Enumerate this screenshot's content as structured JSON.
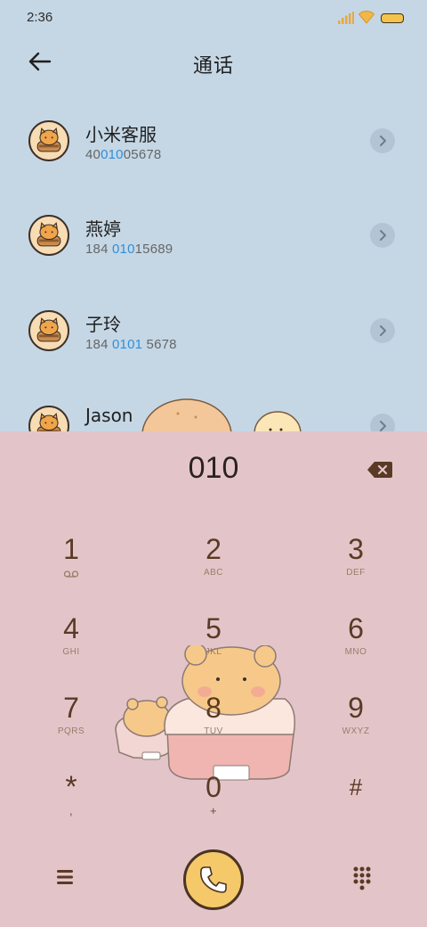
{
  "status_bar": {
    "time": "2:36"
  },
  "header": {
    "title": "通话"
  },
  "contacts": [
    {
      "name": "小米客服",
      "number_pre": "40",
      "number_match": "010",
      "number_post": "05678"
    },
    {
      "name": "燕婷",
      "number_pre": "184 ",
      "number_match": "010",
      "number_post": "15689"
    },
    {
      "name": "子玲",
      "number_pre": "184 ",
      "number_match": "0101",
      "number_post": " 5678"
    },
    {
      "name": "Jason",
      "number_pre": "",
      "number_match": "",
      "number_post": ""
    }
  ],
  "dialer": {
    "entered": "010",
    "keys": [
      {
        "digit": "1",
        "letters": ""
      },
      {
        "digit": "2",
        "letters": "ABC"
      },
      {
        "digit": "3",
        "letters": "DEF"
      },
      {
        "digit": "4",
        "letters": "GHI"
      },
      {
        "digit": "5",
        "letters": "JKL"
      },
      {
        "digit": "6",
        "letters": "MNO"
      },
      {
        "digit": "7",
        "letters": "PQRS"
      },
      {
        "digit": "8",
        "letters": "TUV"
      },
      {
        "digit": "9",
        "letters": "WXYZ"
      },
      {
        "digit": "*",
        "letters": ","
      },
      {
        "digit": "0",
        "letters": "+"
      },
      {
        "digit": "#",
        "letters": ""
      }
    ]
  },
  "colors": {
    "top_bg": "#c5d7e5",
    "pad_bg": "#e3c5c9",
    "accent": "#2f8fd9",
    "call": "#f5c86a",
    "digit": "#5a3a24"
  },
  "icons": [
    "back-arrow-icon",
    "signal-icon",
    "wifi-icon",
    "battery-icon",
    "chevron-right-icon",
    "backspace-icon",
    "voicemail-icon",
    "menu-icon",
    "phone-icon",
    "dialpad-icon"
  ]
}
